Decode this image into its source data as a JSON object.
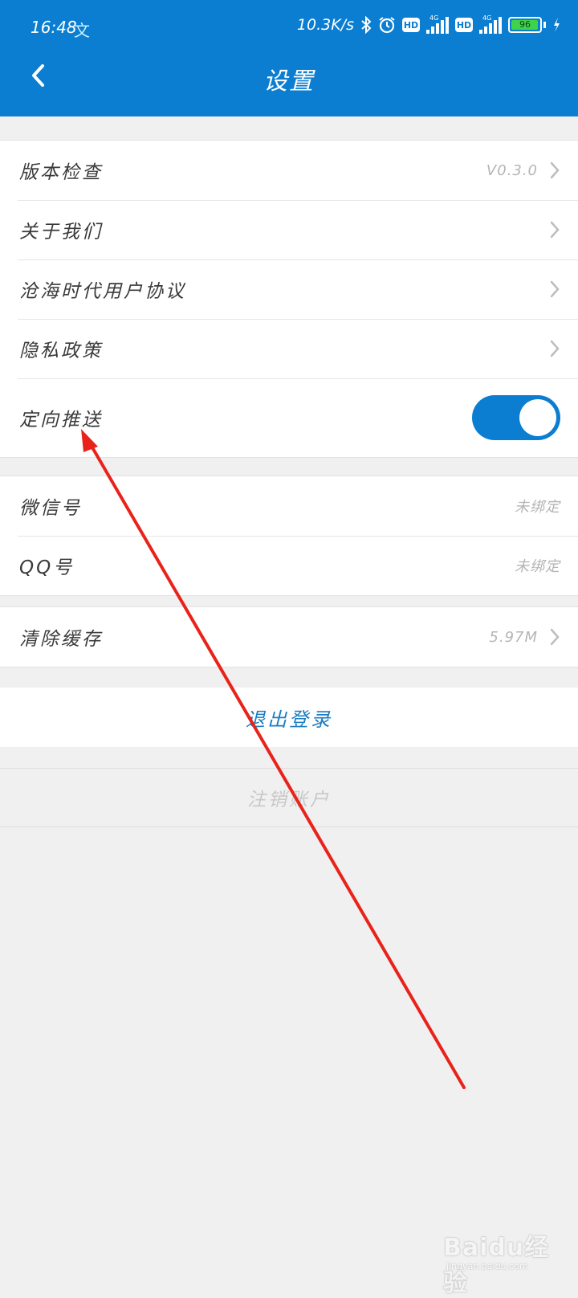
{
  "status_bar": {
    "time": "16:48",
    "input_indicator": "文",
    "net_speed": "10.3K/s",
    "network_type_1": "4G",
    "network_type_2": "4G",
    "hd_label": "HD",
    "battery_level": "96",
    "battery_fraction": 0.96
  },
  "header": {
    "title": "设置",
    "back_icon": "chevron-left-icon",
    "background_color": "#0b7ed1"
  },
  "groups": {
    "about": [
      {
        "label": "版本检查",
        "value": "V0.3.0",
        "chevron": true
      },
      {
        "label": "关于我们",
        "value": "",
        "chevron": true
      },
      {
        "label": "沧海时代用户协议",
        "value": "",
        "chevron": true
      },
      {
        "label": "隐私政策",
        "value": "",
        "chevron": true
      },
      {
        "label": "定向推送",
        "toggle": true,
        "toggle_on": true
      }
    ],
    "binding": [
      {
        "label": "微信号",
        "value": "未绑定"
      },
      {
        "label": "QQ号",
        "value": "未绑定"
      }
    ],
    "cache": [
      {
        "label": "清除缓存",
        "value": "5.97M",
        "chevron": true
      }
    ]
  },
  "actions": {
    "logout_label": "退出登录",
    "cancel_account_label": "注销账户"
  },
  "watermark": {
    "main": "Baidu经验",
    "sub": "jingyan.baidu.com"
  },
  "colors": {
    "accent": "#0b7ed1",
    "logout_text": "#1c7ec2",
    "annotation_arrow": "#e8231b"
  }
}
